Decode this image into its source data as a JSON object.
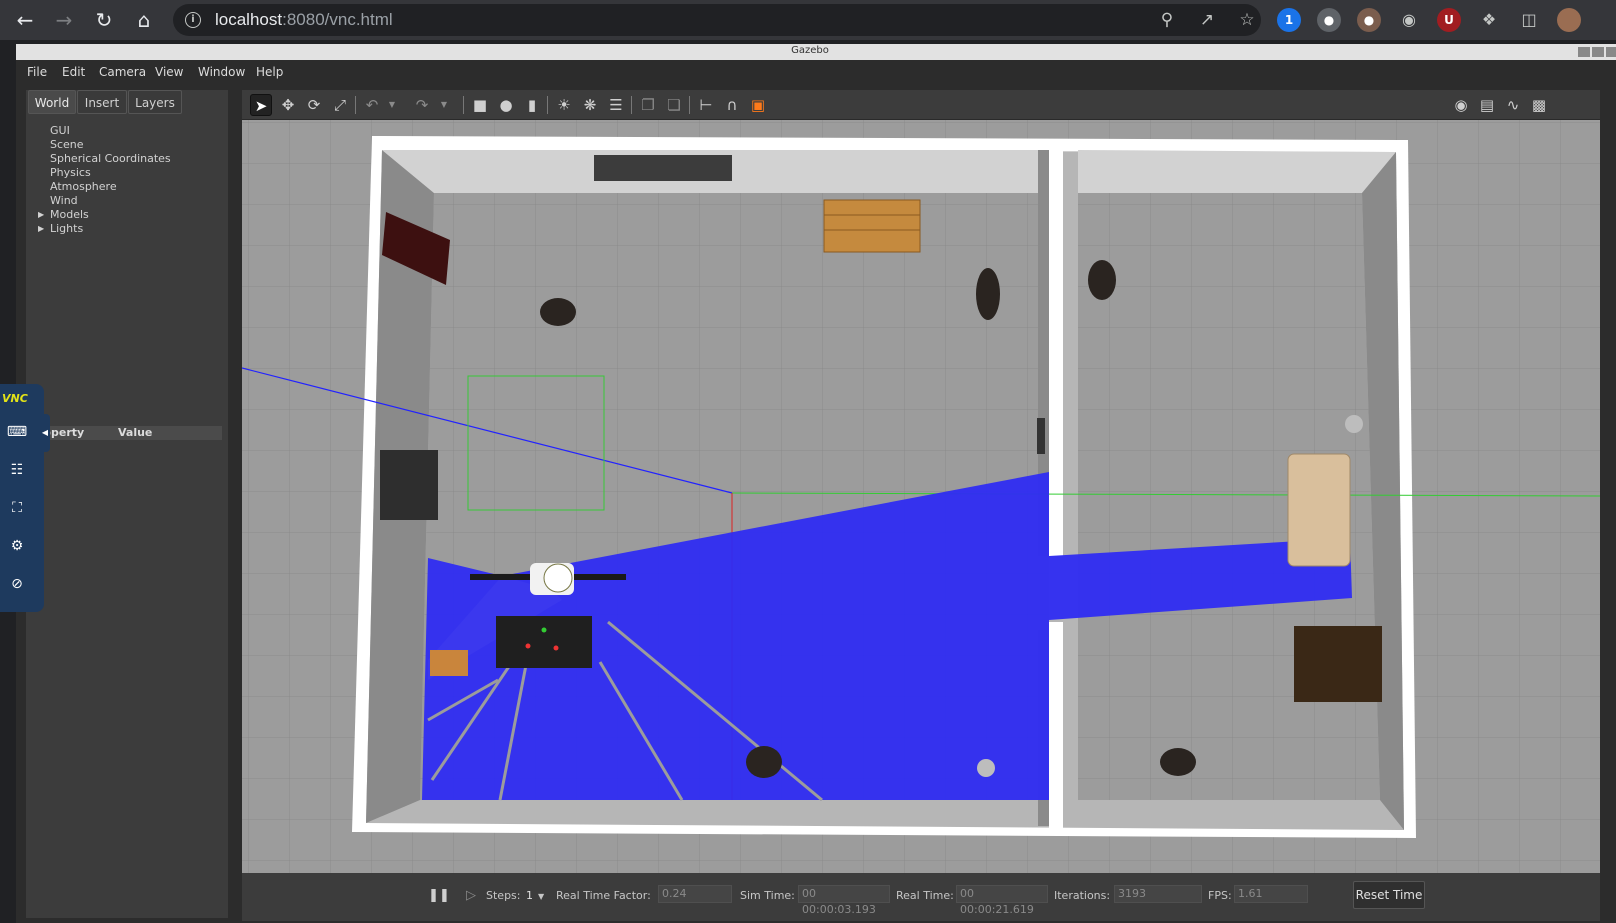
{
  "browser": {
    "url_host": "localhost",
    "url_rest": ":8080/vnc.html"
  },
  "window": {
    "title": "Gazebo"
  },
  "menu": [
    "File",
    "Edit",
    "Camera",
    "View",
    "Window",
    "Help"
  ],
  "left_panel": {
    "tabs": [
      "World",
      "Insert",
      "Layers"
    ],
    "tree": [
      "GUI",
      "Scene",
      "Spherical Coordinates",
      "Physics",
      "Atmosphere",
      "Wind",
      "Models",
      "Lights"
    ],
    "property_header": {
      "property": "roperty",
      "value": "Value"
    }
  },
  "vnc": {
    "logo": "VNC"
  },
  "bottom": {
    "steps_label": "Steps:",
    "steps_value": "1",
    "rtf_label": "Real Time Factor:",
    "rtf_value": "0.24",
    "sim_label": "Sim Time:",
    "sim_value": "00 00:00:03.193",
    "real_label": "Real Time:",
    "real_value": "00 00:00:21.619",
    "iter_label": "Iterations:",
    "iter_value": "3193",
    "fps_label": "FPS:",
    "fps_value": "1.61",
    "reset_label": "Reset Time"
  },
  "colors": {
    "laser": "#2f2cf2",
    "floor": "#9a9a9a",
    "wall": "#d9d9d9"
  }
}
